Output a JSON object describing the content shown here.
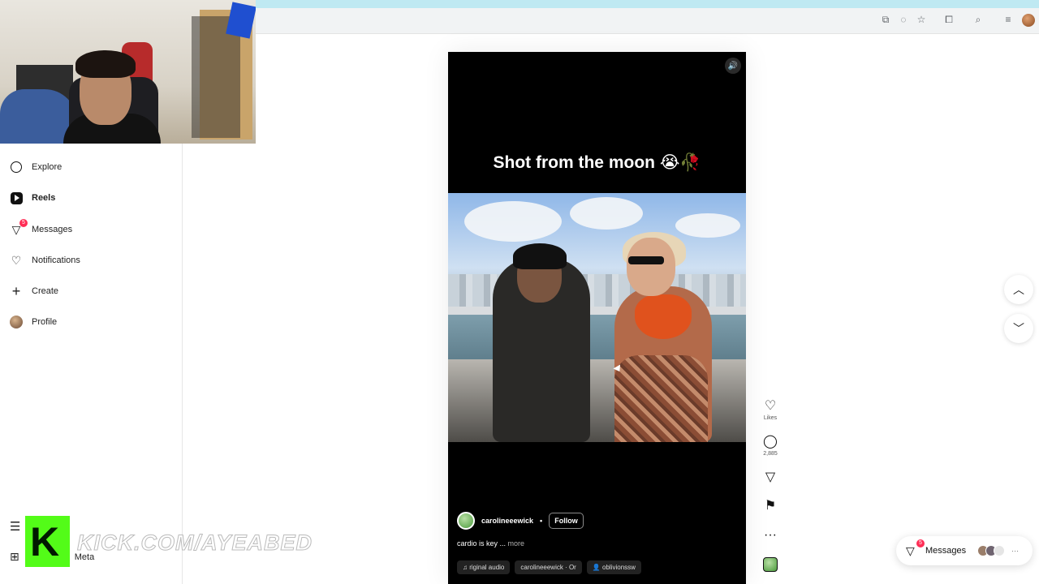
{
  "browser": {
    "toolbar_icons": [
      "cast-icon",
      "eye-off-icon",
      "star-icon",
      "extensions-icon",
      "tab-search-icon",
      "reading-list-icon"
    ]
  },
  "sidebar": {
    "items": [
      {
        "label": "Explore",
        "icon": "compass-icon"
      },
      {
        "label": "Reels",
        "icon": "reels-icon",
        "active": true
      },
      {
        "label": "Messages",
        "icon": "send-icon",
        "badge": "5"
      },
      {
        "label": "Notifications",
        "icon": "heart-icon"
      },
      {
        "label": "Create",
        "icon": "plus-icon"
      },
      {
        "label": "Profile",
        "icon": "avatar"
      }
    ],
    "bottom": [
      {
        "label": "More",
        "icon": "hamburger-icon"
      },
      {
        "label": "Also from Meta",
        "icon": "grid-icon"
      }
    ],
    "bottom_visible_text": [
      "Meta"
    ]
  },
  "overlay": {
    "kick_letter": "K",
    "kick_url": "KICK.COM/AYEABED"
  },
  "reel": {
    "caption": "Shot from the moon 😭🥀",
    "creator": "carolineeewick",
    "separator": "•",
    "follow_label": "Follow",
    "description": "cardio is key ...",
    "more_label": "more",
    "audio_chips": [
      "♫ riginal audio",
      "carolineeewick · Or",
      "👤 oblivionssw"
    ],
    "mute_icon": "volume-icon"
  },
  "actions": {
    "likes_label": "Likes",
    "comments_count": "2,885",
    "more_glyph": "···"
  },
  "messages_pill": {
    "label": "Messages",
    "badge": "5",
    "dots": "···"
  },
  "colors": {
    "accent_badge": "#ff2d55",
    "kick_green": "#53fc18",
    "tab_strip": "#bfe9f2"
  }
}
